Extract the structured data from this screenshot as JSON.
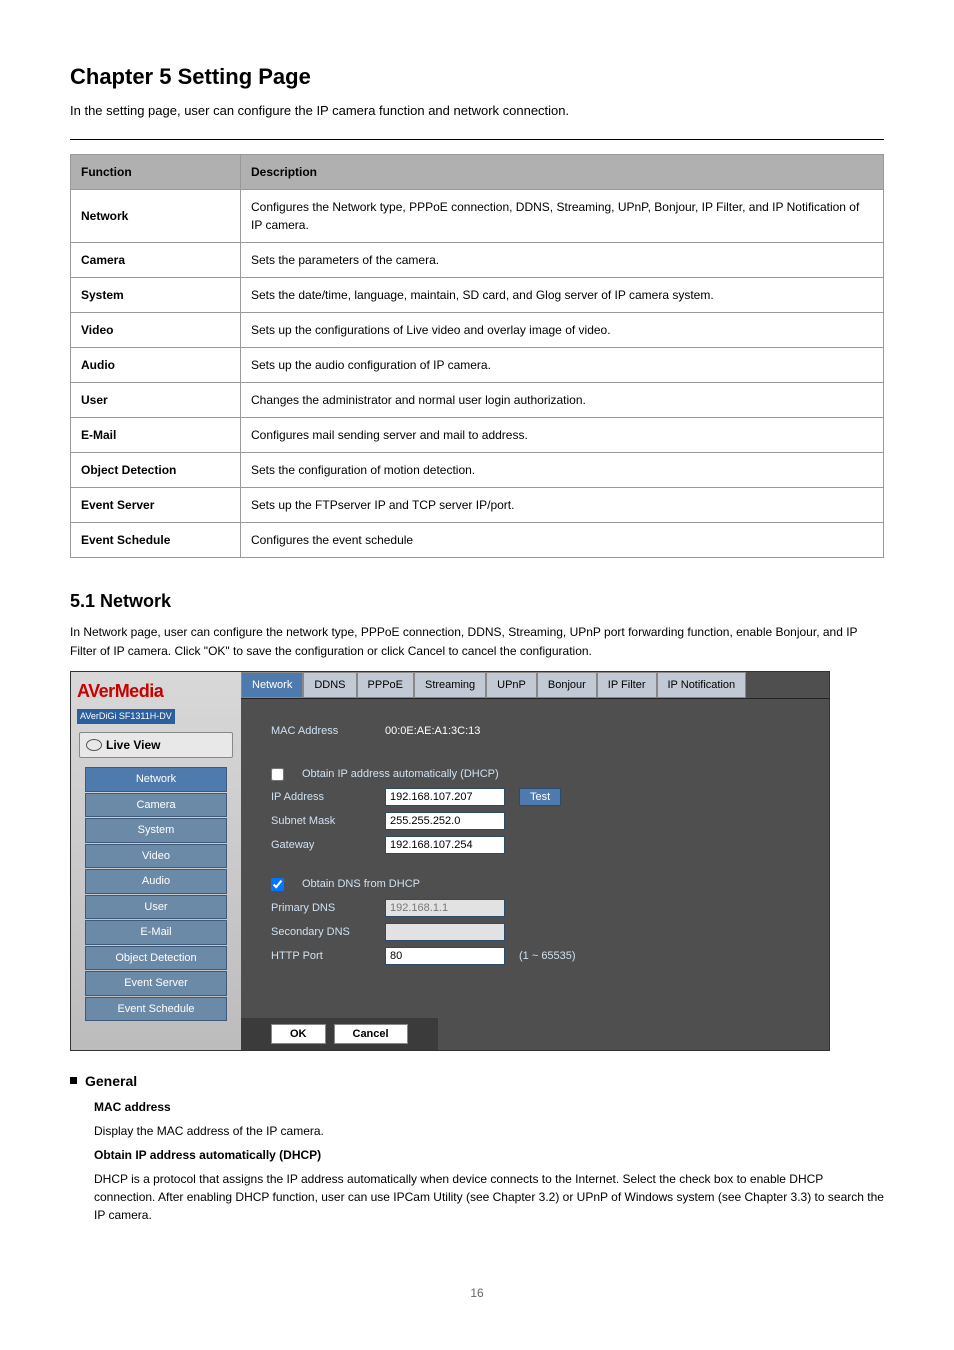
{
  "chapter": {
    "title": "Chapter 5 Setting Page",
    "subtitle": "In the setting page, user can configure the IP camera function and network connection."
  },
  "table": {
    "head_col1": "Function",
    "head_col2": "Description",
    "rows": [
      {
        "fn": "Network",
        "desc": "Configures the Network type, PPPoE connection, DDNS, Streaming, UPnP, Bonjour, IP Filter, and IP Notification of IP camera."
      },
      {
        "fn": "Camera",
        "desc": "Sets the parameters of the camera."
      },
      {
        "fn": "System",
        "desc": "Sets the date/time, language, maintain, SD card, and Glog server of IP camera system."
      },
      {
        "fn": "Video",
        "desc": "Sets up the configurations of Live video and overlay image of video."
      },
      {
        "fn": "Audio",
        "desc": "Sets up the audio configuration of IP camera."
      },
      {
        "fn": "User",
        "desc": "Changes the administrator and normal user login authorization."
      },
      {
        "fn": "E-Mail",
        "desc": "Configures mail sending server and mail to address."
      },
      {
        "fn": "Object Detection",
        "desc": "Sets the configuration of motion detection."
      },
      {
        "fn": "Event Server",
        "desc": "Sets up the FTPserver IP and TCP server IP/port."
      },
      {
        "fn": "Event Schedule",
        "desc": "Configures the event schedule"
      }
    ]
  },
  "network": {
    "heading": "5.1 Network",
    "intro": "In Network page, user can configure the network type, PPPoE connection, DDNS, Streaming, UPnP port forwarding function, enable Bonjour, and IP Filter of IP camera. Click \"OK\" to save the configuration or click Cancel to cancel the configuration."
  },
  "ss": {
    "logo": "AVerMedia",
    "logo_sub": "AVerDiGi SF1311H-DV",
    "live": "Live View",
    "navs": [
      "Network",
      "Camera",
      "System",
      "Video",
      "Audio",
      "User",
      "E-Mail",
      "Object Detection",
      "Event Server",
      "Event Schedule"
    ],
    "tabs": [
      "Network",
      "DDNS",
      "PPPoE",
      "Streaming",
      "UPnP",
      "Bonjour",
      "IP Filter",
      "IP Notification"
    ],
    "mac_label": "MAC Address",
    "mac_val": "00:0E:AE:A1:3C:13",
    "dhcp_chk": "Obtain IP address automatically (DHCP)",
    "ip_label": "IP Address",
    "ip_val": "192.168.107.207",
    "test": "Test",
    "mask_label": "Subnet Mask",
    "mask_val": "255.255.252.0",
    "gw_label": "Gateway",
    "gw_val": "192.168.107.254",
    "dns_chk": "Obtain DNS from DHCP",
    "pdns_label": "Primary DNS",
    "pdns_val": "192.168.1.1",
    "sdns_label": "Secondary DNS",
    "http_label": "HTTP Port",
    "http_val": "80",
    "http_range": "(1 ~ 65535)",
    "ok": "OK",
    "cancel": "Cancel"
  },
  "general": {
    "heading": "General",
    "mac_title": "MAC address",
    "mac_desc": "Display the MAC address of the IP camera.",
    "dhcp_title": "Obtain IP address automatically (DHCP)",
    "dhcp_desc": "DHCP is a protocol that assigns the IP address automatically when device connects to the Internet. Select the check box to enable DHCP connection. After enabling DHCP function, user can use IPCam Utility (see Chapter 3.2) or UPnP of Windows system (see Chapter 3.3) to search the IP camera."
  },
  "page_no": "16"
}
